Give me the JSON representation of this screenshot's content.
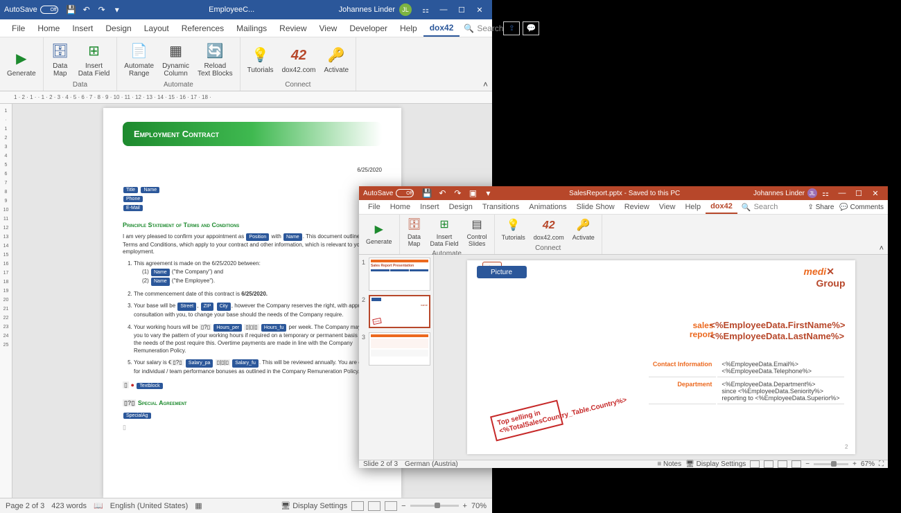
{
  "word": {
    "autosave_label": "AutoSave",
    "autosave_state": "Off",
    "doc_title": "EmployeeC...",
    "user_name": "Johannes Linder",
    "user_initials": "JL",
    "tabs": [
      "File",
      "Home",
      "Insert",
      "Design",
      "Layout",
      "References",
      "Mailings",
      "Review",
      "View",
      "Developer",
      "Help",
      "dox42"
    ],
    "active_tab": "dox42",
    "search_label": "Search",
    "ribbon": {
      "generate": "Generate",
      "data_map": "Data\nMap",
      "insert_field": "Insert\nData Field",
      "auto_range": "Automate\nRange",
      "dyn_col": "Dynamic\nColumn",
      "reload": "Reload\nText Blocks",
      "tutorials": "Tutorials",
      "dox42com": "dox42.com",
      "activate": "Activate",
      "group_data": "Data",
      "group_automate": "Automate",
      "group_connect": "Connect"
    },
    "ruler": "1 · 2 · 1 ·   · 1 · 2 · 3 · 4 · 5 · 6 · 7 · 8 · 9 · 10 · 11 · 12 · 13 · 14 · 15 · 16 · 17 · 18 ·",
    "ruler_v": [
      "1",
      "·",
      "1",
      "2",
      "3",
      "4",
      "5",
      "6",
      "7",
      "8",
      "9",
      "10",
      "11",
      "12",
      "13",
      "14",
      "15",
      "16",
      "17",
      "18",
      "19",
      "20",
      "21",
      "22",
      "23",
      "24",
      "25"
    ],
    "doc": {
      "header": "Employment Contract",
      "date": "6/25/2020",
      "fields": {
        "title": "Title",
        "name": "Name",
        "phone": "Phone",
        "email": "E-Mail"
      },
      "section1": "Principle Statement of Terms and Conditions",
      "intro_a": "I am very pleased to confirm your appointment as ",
      "intro_b": " with ",
      "intro_c": ". This document outlines the Terms and Conditions, which apply to your contract and other information, which is relevant to your employment.",
      "pill_position": "Position",
      "pill_name": "Name",
      "item1": "This agreement is made on the 6/25/2020 between:",
      "item1a": "(1) ",
      "item1a_txt": " (\"the Company\") and",
      "item1b": "(2) ",
      "item1b_txt": " (\"the Employee\").",
      "pill_comp": "Name",
      "pill_emp": "Name",
      "item2_a": "The commencement date of this contract is ",
      "item2_b": "6/25/2020.",
      "item3_a": "Your base will be ",
      "item3_b": ", however the Company reserves the right, with appropriate consultation with you, to change your base should the needs of the Company require.",
      "pill_street": "Street",
      "pill_zip": "ZIP",
      "pill_city": "City",
      "item4_a": "Your working hours will be ",
      "item4_b": " per week. The Company may require you to vary the pattern of your working hours if required on a temporary or permanent basis should the needs of the post require this. Overtime payments are made in line with the Company Remuneration Policy.",
      "pill_hours": "Hours_per",
      "pill_hours2": "Hours_fu",
      "item5_a": "Your salary is €",
      "item5_b": ". This will be reviewed annually. You are eligible for individual / team performance bonuses as outlined in the Company Remuneration Policy.",
      "pill_salary": "Salary_pa",
      "pill_salary2": "Salary_fu",
      "pill_textblock": "Textblock",
      "section2": "Special Agreement",
      "pill_special": "SpecialAg"
    },
    "status": {
      "page": "Page 2 of 3",
      "words": "423 words",
      "lang": "English (United States)",
      "display": "Display Settings",
      "zoom": "70%"
    }
  },
  "ppt": {
    "autosave_label": "AutoSave",
    "autosave_state": "Off",
    "doc_title": "SalesReport.pptx - Saved to this PC",
    "user_name": "Johannes Linder",
    "tabs": [
      "File",
      "Home",
      "Insert",
      "Design",
      "Transitions",
      "Animations",
      "Slide Show",
      "Review",
      "View",
      "Help",
      "dox42"
    ],
    "active_tab": "dox42",
    "search_label": "Search",
    "share": "Share",
    "comments": "Comments",
    "ribbon": {
      "generate": "Generate",
      "data_map": "Data\nMap",
      "insert_field": "Insert\nData Field",
      "ctrl_slides": "Control\nSlides",
      "tutorials": "Tutorials",
      "dox42com": "dox42.com",
      "activate": "Activate",
      "group_automate": "Automate",
      "group_connect": "Connect"
    },
    "thumbs": [
      "1",
      "2",
      "3"
    ],
    "slide": {
      "picture": "Picture",
      "logo1": "medi",
      "logo2": "Group",
      "sales": "sales",
      "report": "report",
      "first": "<%EmployeeData.FirstName%>",
      "last": "<%EmployeeData.LastName%>",
      "contact_label": "Contact Information",
      "contact_val1": "<%EmployeeData.Email%>",
      "contact_val2": "<%EmployeeData.Telephone%>",
      "dept_label": "Department",
      "dept_val1": "<%EmployeeData.Department%>",
      "dept_val2a": "since ",
      "dept_val2b": "<%EmployeeData.Seniority%>",
      "dept_val3a": "reporting to ",
      "dept_val3b": "<%EmployeeData.Superior%>",
      "stamp_a": "Top selling in",
      "stamp_b": "<%TotalSalesCountry_Table.Country%>",
      "num": "2"
    },
    "status": {
      "slide": "Slide 2 of 3",
      "lang": "German (Austria)",
      "notes": "Notes",
      "display": "Display Settings",
      "zoom": "67%"
    }
  }
}
